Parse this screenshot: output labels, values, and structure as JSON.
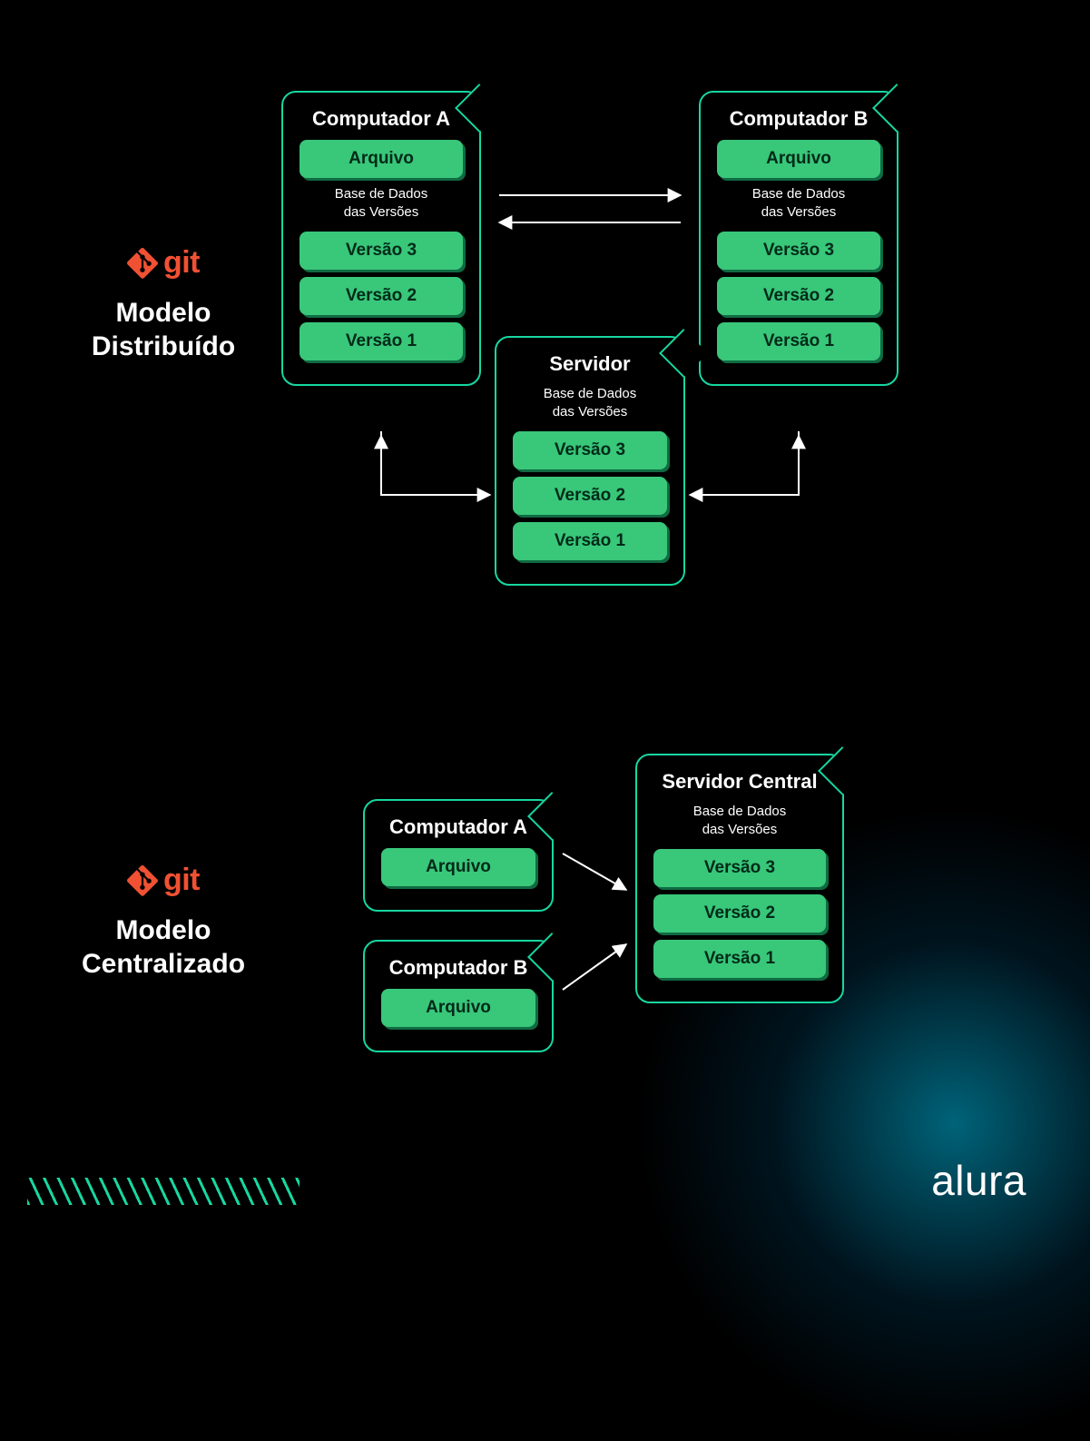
{
  "distributed": {
    "git_label": "git",
    "title_line1": "Modelo",
    "title_line2": "Distribuído",
    "computer_a": {
      "title": "Computador A",
      "file_label": "Arquivo",
      "db_line1": "Base de Dados",
      "db_line2": "das Versões",
      "versions": [
        "Versão 3",
        "Versão 2",
        "Versão 1"
      ]
    },
    "computer_b": {
      "title": "Computador B",
      "file_label": "Arquivo",
      "db_line1": "Base de Dados",
      "db_line2": "das Versões",
      "versions": [
        "Versão 3",
        "Versão 2",
        "Versão 1"
      ]
    },
    "server": {
      "title": "Servidor",
      "db_line1": "Base de Dados",
      "db_line2": "das Versões",
      "versions": [
        "Versão 3",
        "Versão 2",
        "Versão 1"
      ]
    }
  },
  "centralized": {
    "git_label": "git",
    "title_line1": "Modelo",
    "title_line2": "Centralizado",
    "computer_a": {
      "title": "Computador A",
      "file_label": "Arquivo"
    },
    "computer_b": {
      "title": "Computador B",
      "file_label": "Arquivo"
    },
    "server": {
      "title": "Servidor Central",
      "db_line1": "Base de Dados",
      "db_line2": "das Versões",
      "versions": [
        "Versão 3",
        "Versão 2",
        "Versão 1"
      ]
    }
  },
  "watermark": "alura"
}
